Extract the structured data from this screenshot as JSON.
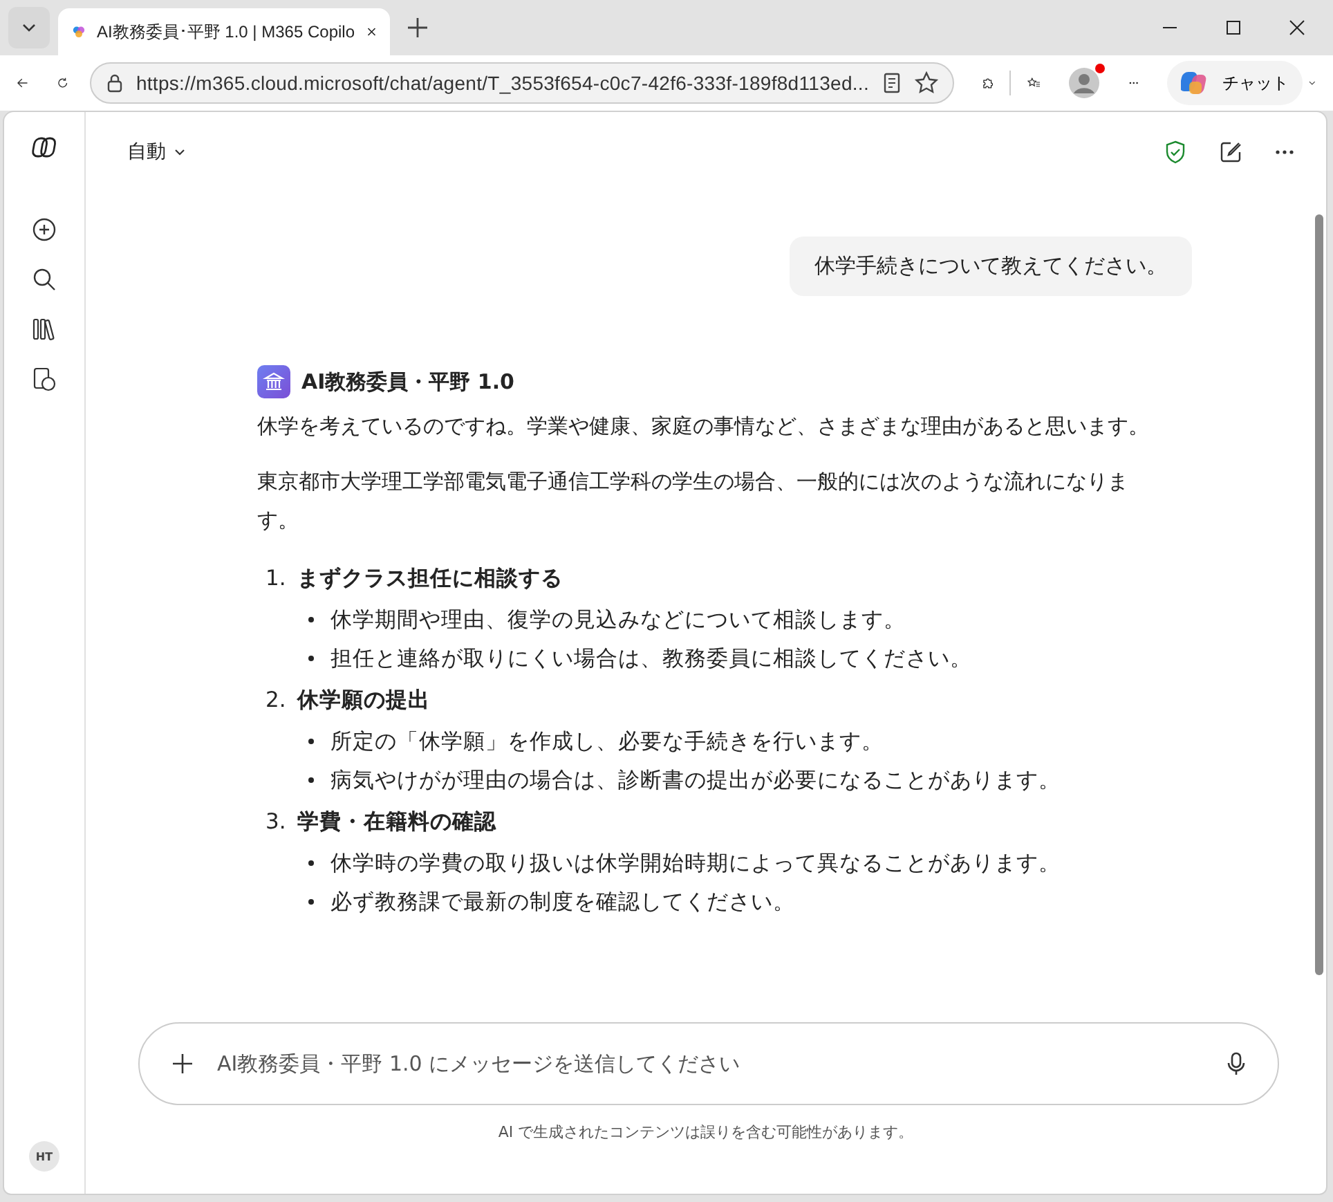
{
  "browser": {
    "tab_title": "AI教務委員･平野 1.0 | M365 Copilo",
    "address": "https://m365.cloud.microsoft/chat/agent/T_3553f654-c0c7-42f6-333f-189f8d113ed...",
    "copilot_label": "チャット",
    "profile_notification": true
  },
  "header": {
    "mode": "自動"
  },
  "user_message": "休学手続きについて教えてください。",
  "agent": {
    "name": "AI教務委員・平野 1.0",
    "paragraphs": [
      "休学を考えているのですね。学業や健康、家庭の事情など、さまざまな理由があると思います。",
      "東京都市大学理工学部電気電子通信工学科の学生の場合、一般的には次のような流れになります。"
    ],
    "steps": [
      {
        "number": "1.",
        "title": "まずクラス担任に相談する",
        "bullets": [
          "休学期間や理由、復学の見込みなどについて相談します。",
          "担任と連絡が取りにくい場合は、教務委員に相談してください。"
        ]
      },
      {
        "number": "2.",
        "title": "休学願の提出",
        "bullets": [
          "所定の「休学願」を作成し、必要な手続きを行います。",
          "病気やけがが理由の場合は、診断書の提出が必要になることがあります。"
        ]
      },
      {
        "number": "3.",
        "title": "学費・在籍料の確認",
        "bullets": [
          "休学時の学費の取り扱いは休学開始時期によって異なることがあります。",
          "必ず教務課で最新の制度を確認してください。"
        ]
      }
    ]
  },
  "composer": {
    "placeholder": "AI教務委員・平野 1.0 にメッセージを送信してください"
  },
  "disclaimer": "AI で生成されたコンテンツは誤りを含む可能性があります。",
  "user_avatar": "HT"
}
